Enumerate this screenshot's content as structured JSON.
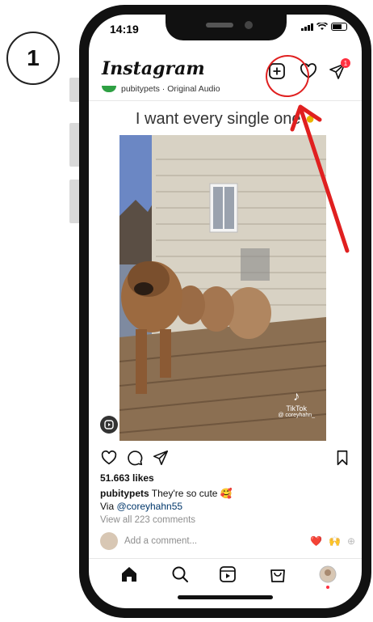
{
  "annotation": {
    "step_number": "1"
  },
  "status_bar": {
    "time": "14:19"
  },
  "header": {
    "logo": "Instagram",
    "dm_badge": "1"
  },
  "post": {
    "audio_line": "pubitypets · Original Audio",
    "caption_overlay": "I want every single one",
    "watermark_brand": "TikTok",
    "watermark_handle": "@ coreyhahn_",
    "likes": "51.663 likes",
    "author": "pubitypets",
    "caption": "They're so cute",
    "caption_emoji": "🥰",
    "via_prefix": "Via ",
    "mention": "@coreyhahn55",
    "view_comments": "View all 223 comments",
    "comment_placeholder": "Add a comment...",
    "quick_emojis": [
      "❤️",
      "🙌",
      "⊕"
    ]
  },
  "colors": {
    "accent_red": "#e02020",
    "mention": "#00376b"
  },
  "icons": [
    "add-post-icon",
    "heart-icon",
    "direct-message-icon",
    "comment-icon",
    "share-icon",
    "bookmark-icon",
    "home-icon",
    "search-icon",
    "reels-icon",
    "shop-icon",
    "profile-avatar-icon"
  ]
}
